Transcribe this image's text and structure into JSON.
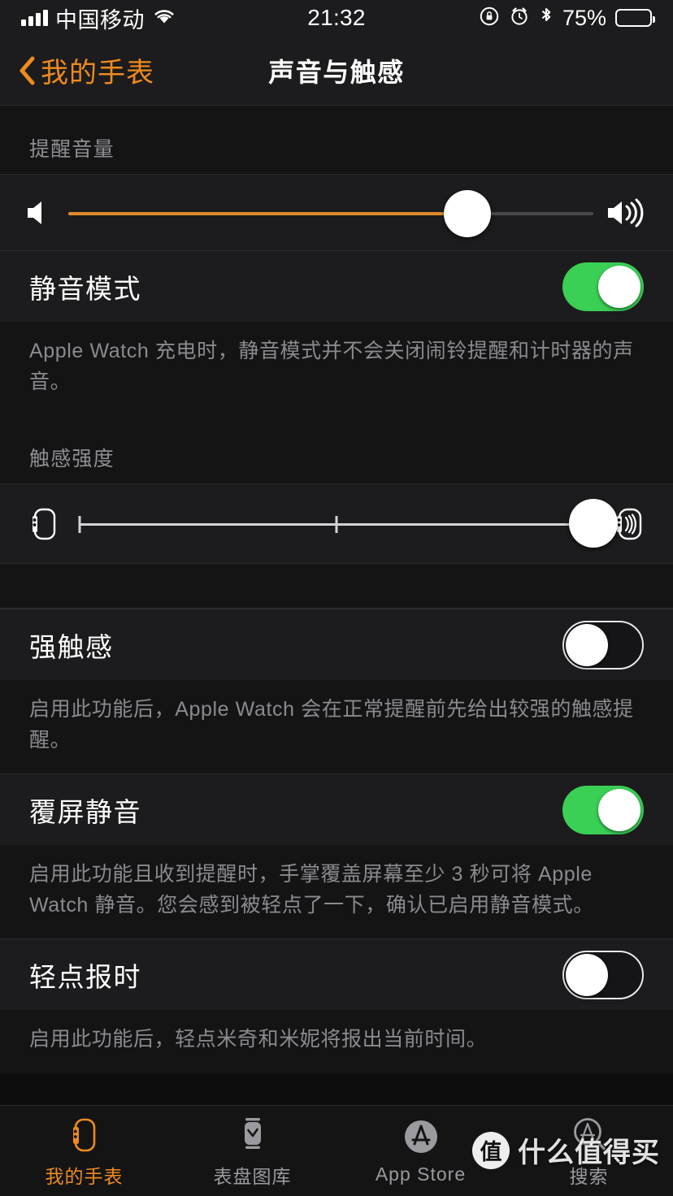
{
  "status_bar": {
    "carrier": "中国移动",
    "time": "21:32",
    "battery_percent": "75%",
    "icons": [
      "signal-bars-icon",
      "wifi-icon",
      "rotation-lock-icon",
      "alarm-clock-icon",
      "bluetooth-icon",
      "battery-icon"
    ],
    "battery_level": 75
  },
  "nav": {
    "back_label": "我的手表",
    "title": "声音与触感"
  },
  "sections": {
    "volume": {
      "header": "提醒音量",
      "left_icon": "speaker-low-icon",
      "right_icon": "speaker-high-icon",
      "value_percent": 76
    },
    "silent_mode": {
      "title": "静音模式",
      "toggle_state": "on",
      "note": "Apple Watch 充电时，静音模式并不会关闭闹铃提醒和计时器的声音。"
    },
    "haptic": {
      "header": "触感强度",
      "left_icon": "watch-haptic-weak-icon",
      "right_icon": "watch-haptic-strong-icon",
      "value_percent": 100,
      "tick_percent": 50
    },
    "prominent_haptic": {
      "title": "强触感",
      "toggle_state": "off",
      "note": "启用此功能后，Apple Watch 会在正常提醒前先给出较强的触感提醒。"
    },
    "cover_to_mute": {
      "title": "覆屏静音",
      "toggle_state": "on",
      "note": "启用此功能且收到提醒时，手掌覆盖屏幕至少 3 秒可将 Apple Watch 静音。您会感到被轻点了一下，确认已启用静音模式。"
    },
    "tap_to_speak_time": {
      "title": "轻点报时",
      "toggle_state": "off",
      "note": "启用此功能后，轻点米奇和米妮将报出当前时间。"
    }
  },
  "tab_bar": {
    "items": [
      {
        "label": "我的手表",
        "icon": "watch-icon",
        "active": true
      },
      {
        "label": "表盘图库",
        "icon": "watch-face-gallery-icon",
        "active": false
      },
      {
        "label": "App Store",
        "icon": "app-store-icon",
        "active": false
      },
      {
        "label": "搜索",
        "icon": "search-app-store-icon",
        "active": false
      }
    ]
  },
  "watermark": {
    "badge": "值",
    "text": "什么值得买"
  },
  "colors": {
    "accent_orange": "#ee8a1e",
    "toggle_on_green": "#3ad056",
    "slider_fill": "#e08a2c",
    "row_bg": "#1c1c1e",
    "group_bg": "#141415",
    "secondary_text": "#8e8e93"
  }
}
